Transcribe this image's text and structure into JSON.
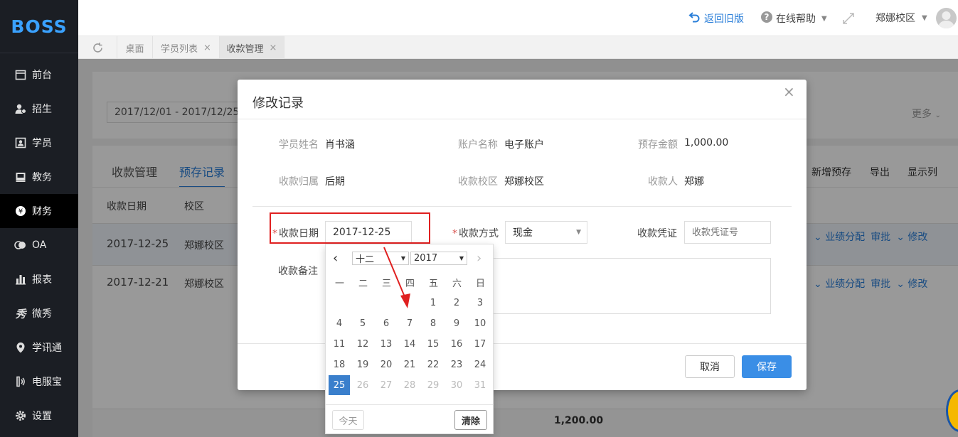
{
  "app": {
    "logo": "BOSS"
  },
  "sidebar": {
    "items": [
      {
        "label": "前台",
        "icon": "calendar-icon"
      },
      {
        "label": "招生",
        "icon": "user-add-icon"
      },
      {
        "label": "学员",
        "icon": "id-card-icon"
      },
      {
        "label": "教务",
        "icon": "book-icon"
      },
      {
        "label": "财务",
        "icon": "yen-icon",
        "active": true
      },
      {
        "label": "OA",
        "icon": "chat-icon"
      },
      {
        "label": "报表",
        "icon": "bar-chart-icon"
      },
      {
        "label": "微秀",
        "icon": "weixiu-icon"
      },
      {
        "label": "学讯通",
        "icon": "location-icon"
      },
      {
        "label": "电服宝",
        "icon": "phone-icon"
      },
      {
        "label": "设置",
        "icon": "gear-icon"
      }
    ]
  },
  "topbar": {
    "back_old": "返回旧版",
    "help": "在线帮助",
    "campus": "郑娜校区"
  },
  "tabs": [
    {
      "label": "桌面",
      "closable": false
    },
    {
      "label": "学员列表",
      "closable": true
    },
    {
      "label": "收款管理",
      "closable": true,
      "active": true
    }
  ],
  "page": {
    "date_range": "2017/12/01 - 2017/12/25",
    "more": "更多",
    "subtabs": [
      "收款管理",
      "预存记录"
    ],
    "actions": [
      "新增预存",
      "导出",
      "显示列"
    ],
    "columns": [
      "收款日期",
      "校区"
    ],
    "rows": [
      {
        "date": "2017-12-25",
        "campus": "郑娜校区",
        "links": [
          "业绩分配",
          "审批",
          "修改"
        ]
      },
      {
        "date": "2017-12-21",
        "campus": "郑娜校区",
        "links": [
          "业绩分配",
          "审批",
          "修改"
        ]
      }
    ],
    "total": "1,200.00"
  },
  "modal": {
    "title": "修改记录",
    "close": "×",
    "info": [
      {
        "label": "学员姓名",
        "value": "肖书涵"
      },
      {
        "label": "账户名称",
        "value": "电子账户"
      },
      {
        "label": "预存金额",
        "value": "1,000.00"
      },
      {
        "label": "收款归属",
        "value": "后期"
      },
      {
        "label": "收款校区",
        "value": "郑娜校区"
      },
      {
        "label": "收款人",
        "value": "郑娜"
      }
    ],
    "form": {
      "date_label": "收款日期",
      "date_value": "2017-12-25",
      "method_label": "收款方式",
      "method_value": "现金",
      "voucher_label": "收款凭证",
      "voucher_placeholder": "收款凭证号",
      "remark_label": "收款备注"
    },
    "cancel": "取消",
    "save": "保存"
  },
  "datepicker": {
    "month": "十二",
    "year": "2017",
    "weekdays": [
      "一",
      "二",
      "三",
      "四",
      "五",
      "六",
      "日"
    ],
    "selected_day": "25",
    "today": "今天",
    "clear": "清除",
    "weeks": [
      [
        "",
        "",
        "",
        "",
        "1",
        "2",
        "3"
      ],
      [
        "4",
        "5",
        "6",
        "7",
        "8",
        "9",
        "10"
      ],
      [
        "11",
        "12",
        "13",
        "14",
        "15",
        "16",
        "17"
      ],
      [
        "18",
        "19",
        "20",
        "21",
        "22",
        "23",
        "24"
      ],
      [
        "25",
        "26",
        "27",
        "28",
        "29",
        "30",
        "31"
      ]
    ],
    "disabled_after": "25"
  },
  "colors": {
    "accent": "#3a8ee6",
    "sidebar": "#1b1e24",
    "required": "#d9534f",
    "highlight_box": "#e02020"
  }
}
